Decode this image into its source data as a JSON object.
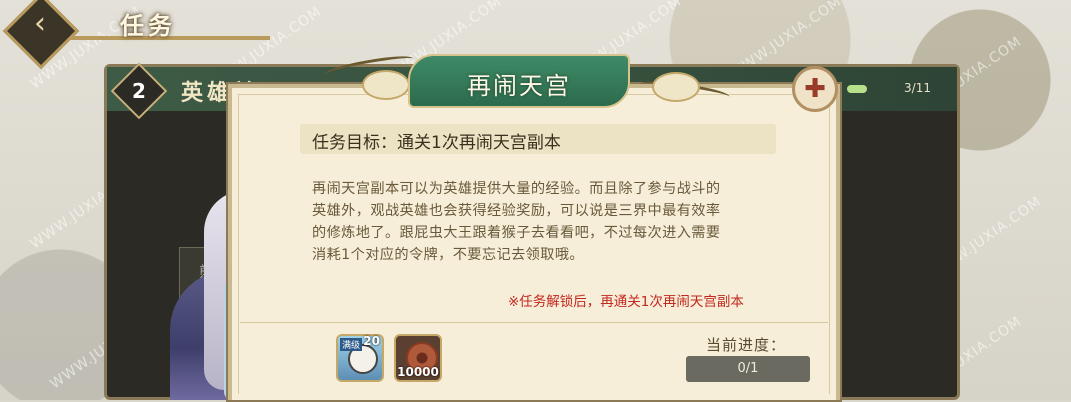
{
  "header": {
    "title": "任务"
  },
  "quest": {
    "number": "2",
    "name": "英雄益…",
    "count": "3/11"
  },
  "dialog": {
    "title": "再闹天宫",
    "goal": "任务目标：通关1次再闹天宫副本",
    "description": [
      "再闹天宫副本可以为英雄提供大量的经验。而且除了参与战斗的",
      "英雄外，观战英雄也会获得经验奖励，可以说是三界中最有效率",
      "的修炼地了。跟屁虫大王跟着猴子去看看吧，不过每次进入需要",
      "消耗1个对应的令牌，不要忘记去领取哦。"
    ],
    "unlock_note": "※任务解锁后，再通关1次再闹天宫副本",
    "rewards": [
      {
        "icon": "hero-fragment-icon",
        "tag": "满级",
        "count": "20"
      },
      {
        "icon": "copper-coin-icon",
        "count": "10000"
      }
    ],
    "progress_label": "当前进度：",
    "progress_text": "0/1",
    "progress_value": 0
  },
  "side_tag": "前往",
  "watermark": "WWW.JUXIA.COM",
  "colors": {
    "banner": "#2c6b4c",
    "note": "#c3271d",
    "panel_bg": "#f6eed8"
  }
}
